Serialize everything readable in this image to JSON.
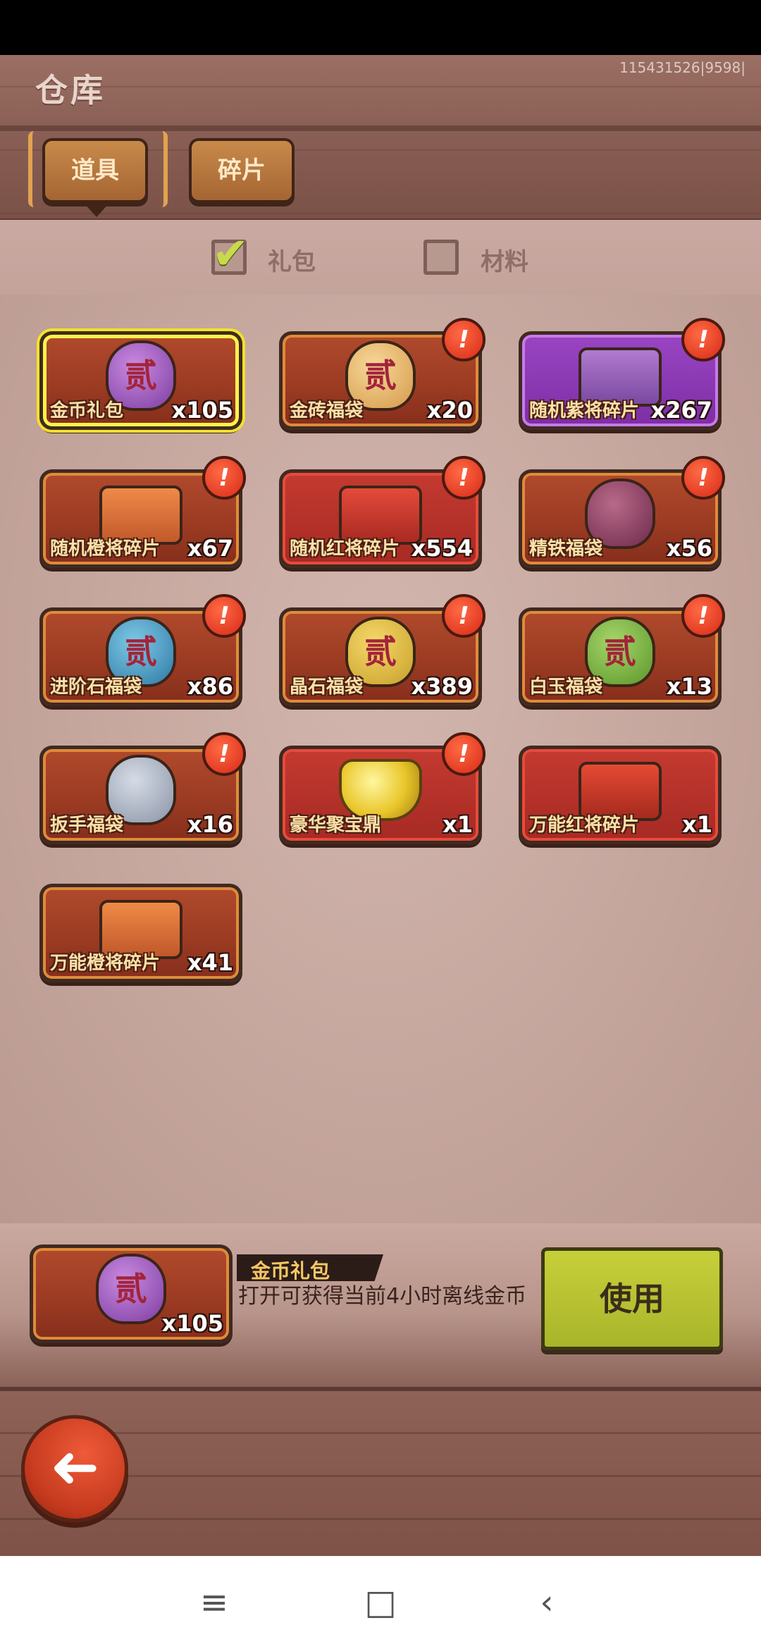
{
  "header": {
    "title": "仓库",
    "user_id": "115431526|9598|",
    "tabs": [
      {
        "label": "道具",
        "active": true
      },
      {
        "label": "碎片",
        "active": false
      }
    ]
  },
  "filters": [
    {
      "label": "礼包",
      "checked": true
    },
    {
      "label": "材料",
      "checked": false
    }
  ],
  "alert_symbol": "!",
  "items": [
    {
      "name": "金币礼包",
      "count": "x105",
      "style": "orange",
      "icon": "gift-bag-icon",
      "alert": false,
      "selected": true
    },
    {
      "name": "金砖福袋",
      "count": "x20",
      "style": "orange",
      "icon": "gold-brick-bag-icon",
      "alert": true
    },
    {
      "name": "随机紫将碎片",
      "count": "x267",
      "style": "purple",
      "icon": "purple-chest-icon",
      "alert": true
    },
    {
      "name": "随机橙将碎片",
      "count": "x67",
      "style": "orange",
      "icon": "orange-chest-icon",
      "alert": true
    },
    {
      "name": "随机红将碎片",
      "count": "x554",
      "style": "red",
      "icon": "red-chest-icon",
      "alert": true
    },
    {
      "name": "精铁福袋",
      "count": "x56",
      "style": "orange",
      "icon": "iron-bag-icon",
      "alert": true
    },
    {
      "name": "进阶石福袋",
      "count": "x86",
      "style": "orange",
      "icon": "stone-bag-icon",
      "alert": true
    },
    {
      "name": "晶石福袋",
      "count": "x389",
      "style": "orange",
      "icon": "crystal-bag-icon",
      "alert": true
    },
    {
      "name": "白玉福袋",
      "count": "x13",
      "style": "orange",
      "icon": "jade-bag-icon",
      "alert": true
    },
    {
      "name": "扳手福袋",
      "count": "x16",
      "style": "orange",
      "icon": "wrench-bag-icon",
      "alert": true
    },
    {
      "name": "豪华聚宝鼎",
      "count": "x1",
      "style": "red",
      "icon": "treasure-cauldron-icon",
      "alert": true
    },
    {
      "name": "万能红将碎片",
      "count": "x1",
      "style": "red",
      "icon": "universal-red-box-icon",
      "alert": false
    },
    {
      "name": "万能橙将碎片",
      "count": "x41",
      "style": "orange",
      "icon": "universal-orange-box-icon",
      "alert": false
    }
  ],
  "detail": {
    "name": "金币礼包",
    "count": "x105",
    "description": "打开可获得当前4小时离线金币",
    "use_label": "使用"
  },
  "footer": {
    "back_icon": "back-arrow-icon"
  },
  "system_nav": {
    "menu": "≡",
    "home": "□",
    "back": "‹"
  },
  "colors": {
    "accent": "#c7cf3a",
    "alert": "#d72a16",
    "selected": "#f3e22a"
  }
}
